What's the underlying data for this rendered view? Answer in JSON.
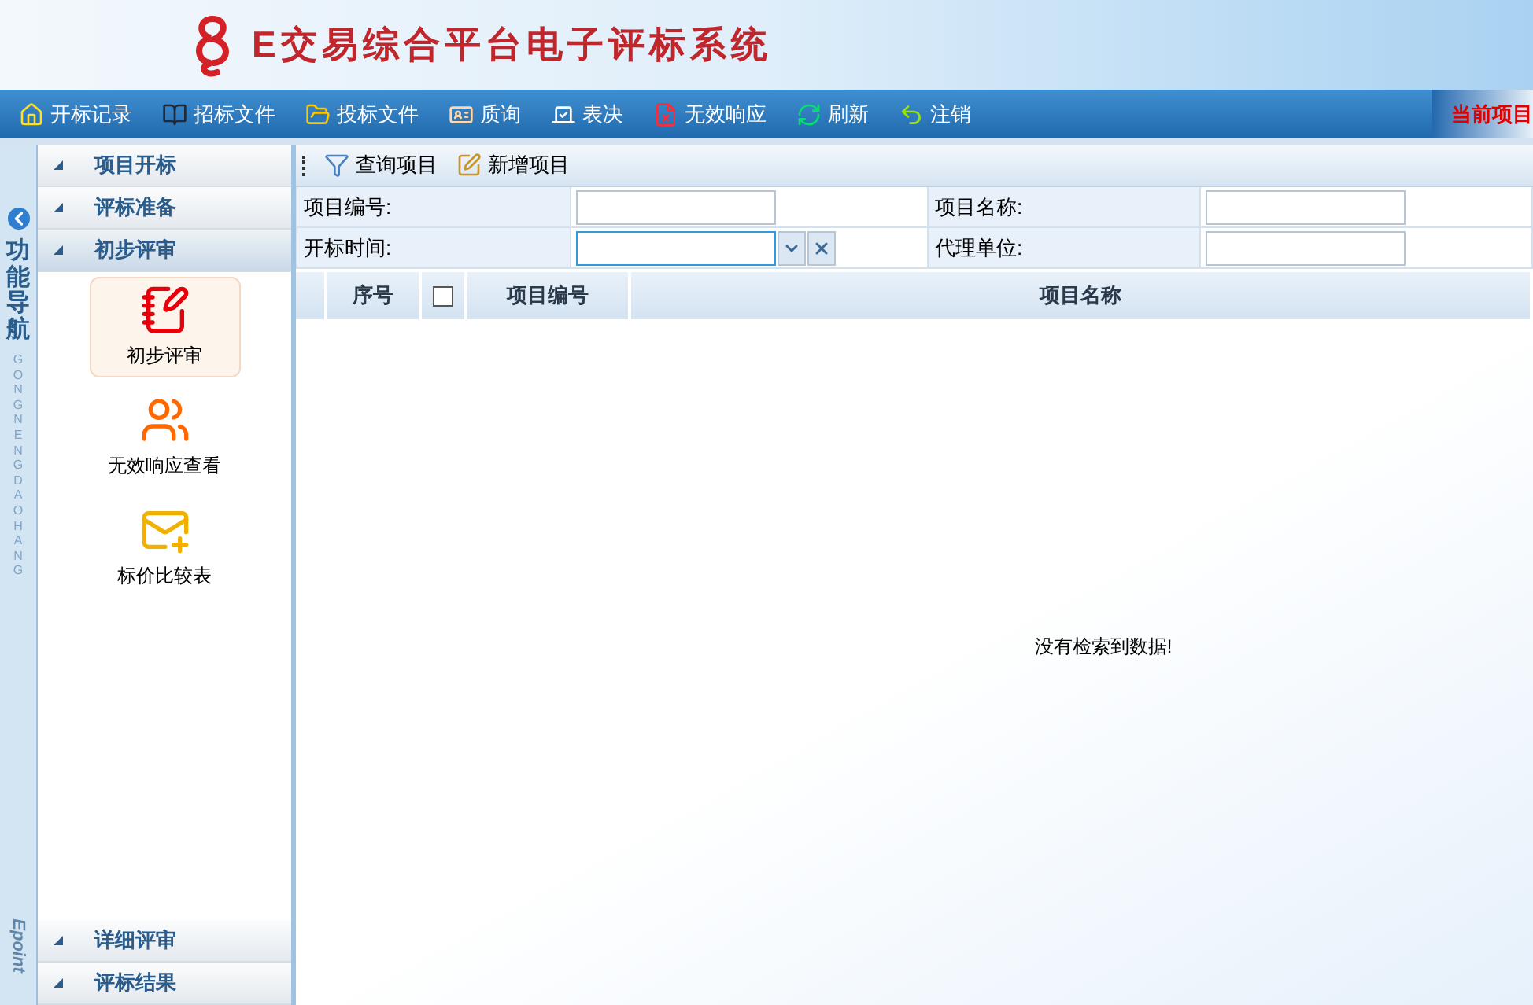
{
  "header": {
    "title": "E交易综合平台电子评标系统"
  },
  "toolbar": {
    "items": [
      {
        "label": "开标记录",
        "kind": "home"
      },
      {
        "label": "招标文件",
        "kind": "book"
      },
      {
        "label": "投标文件",
        "kind": "folder"
      },
      {
        "label": "质询",
        "kind": "card"
      },
      {
        "label": "表决",
        "kind": "vote"
      },
      {
        "label": "无效响应",
        "kind": "invalid"
      },
      {
        "label": "刷新",
        "kind": "refresh"
      },
      {
        "label": "注销",
        "kind": "logout"
      }
    ],
    "current_project": "当前项目"
  },
  "nav_strip": {
    "title": "功能导航",
    "pinyin": "GONG NENG DAO HANG",
    "logo": "Epoint"
  },
  "sidebar": {
    "top_sections": [
      {
        "label": "项目开标",
        "expanded": false
      },
      {
        "label": "评标准备",
        "expanded": false
      },
      {
        "label": "初步评审",
        "expanded": true,
        "items": [
          {
            "label": "初步评审",
            "kind": "review",
            "selected": true
          },
          {
            "label": "无效响应查看",
            "kind": "people",
            "selected": false
          },
          {
            "label": "标价比较表",
            "kind": "mail",
            "selected": false
          }
        ]
      }
    ],
    "bottom_sections": [
      {
        "label": "详细评审",
        "expanded": false
      },
      {
        "label": "评标结果",
        "expanded": false
      }
    ]
  },
  "main_toolbar": {
    "buttons": [
      {
        "label": "查询项目",
        "kind": "filter"
      },
      {
        "label": "新增项目",
        "kind": "edit"
      }
    ]
  },
  "search_form": {
    "fields": [
      {
        "label": "项目编号:",
        "kind": "text",
        "focused": false
      },
      {
        "label": "项目名称:",
        "kind": "text",
        "focused": false
      },
      {
        "label": "开标时间:",
        "kind": "date",
        "focused": true
      },
      {
        "label": "代理单位:",
        "kind": "text",
        "focused": false
      }
    ]
  },
  "table": {
    "columns": [
      {
        "label": "序号",
        "kind": "text"
      },
      {
        "kind": "checkbox",
        "checked": false
      },
      {
        "label": "项目编号",
        "kind": "text"
      },
      {
        "label": "项目名称",
        "kind": "text"
      }
    ],
    "empty_message": "没有检索到数据!"
  }
}
